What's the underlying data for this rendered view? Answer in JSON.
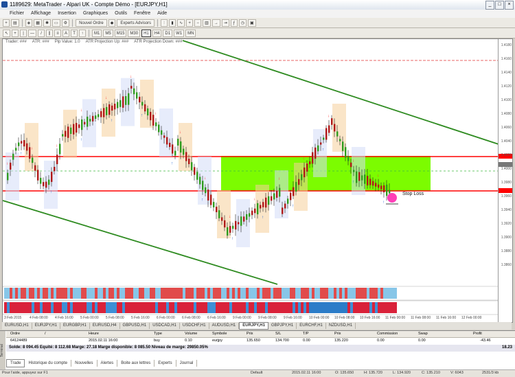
{
  "window": {
    "title": "1189629: MetaTrader - Alpari UK - Compte Démo - [EURJPY,H1]",
    "controls": [
      "_",
      "□",
      "×"
    ]
  },
  "menu": [
    "Fichier",
    "Affichage",
    "Insertion",
    "Graphiques",
    "Outils",
    "Fenêtre",
    "Aide"
  ],
  "toolbar1": {
    "new_order": "Nouvel Ordre",
    "experts": "Experts Advisors"
  },
  "toolbar2": {
    "timeframes": [
      "M1",
      "M5",
      "M15",
      "M30",
      "H1",
      "H4",
      "D1",
      "W1",
      "MN"
    ]
  },
  "chart": {
    "indicators": [
      "Trader: ###",
      "ATR: ###",
      "Pip Value: 1.0",
      "ATR Projection Up: ###",
      "ATR Projection Down: ###"
    ],
    "price_labels": [
      "1.4180",
      "1.4160",
      "1.4140",
      "1.4120",
      "1.4100",
      "1.4080",
      "1.4060",
      "1.4040",
      "1.4020",
      "1.4000",
      "1.3980",
      "1.3960",
      "1.3940",
      "1.3920",
      "1.3900",
      "1.3880",
      "1.3860"
    ],
    "time_labels": [
      "3 Feb 2015",
      "4 Feb 08:00",
      "4 Feb 16:00",
      "5 Feb 00:00",
      "5 Feb 08:00",
      "5 Feb 16:00",
      "6 Feb 00:00",
      "6 Feb 08:00",
      "6 Feb 16:00",
      "9 Feb 00:00",
      "9 Feb 08:00",
      "9 Feb 16:00",
      "10 Feb 00:00",
      "10 Feb 08:00",
      "10 Feb 16:00",
      "11 Feb 00:00",
      "11 Feb 08:00",
      "11 Feb 16:00",
      "12 Feb 00:00"
    ],
    "stop_loss_label": "Stop Loss",
    "colors": {
      "up_candle": "#2e9c1e",
      "down_candle": "#b01818",
      "channel": "#2e8b20",
      "zone": "#7cfc00",
      "resistance": "#ff0000",
      "support": "#ff0000"
    }
  },
  "chart_tabs": [
    "EURUSD,H1",
    "EURJPY,H1",
    "EURGBP,H1",
    "EURUSD,H4",
    "GBPUSD,H1",
    "USDCAD,H1",
    "USDCHF,H1",
    "AUDUSD,H1",
    "EURJPY,H1",
    "GBPJPY,H1",
    "EURCHF,H1",
    "NZDUSD,H1"
  ],
  "active_chart_tab": 8,
  "terminal": {
    "side_label": "Terminal",
    "headers": [
      "Ordre",
      "/",
      "Heure",
      "Type",
      "Volume",
      "Symbole",
      "Prix",
      "S/L",
      "T/P",
      "Prix",
      "Commission",
      "Swap",
      "Profit"
    ],
    "row": [
      "64124489",
      "2015.02.11 16:00",
      "buy",
      "0.10",
      "eurjpy",
      "135.650",
      "134.700",
      "0.00",
      "135.220",
      "0.00",
      "0.00",
      "-43.46"
    ],
    "balance": "Solde: 8 094.45  Equité: 8 112.68  Marge: 27.18  Marge disponible: 8 085.50  Niveau de marge: 29850.05%",
    "balance_total": "18.23",
    "tabs": [
      "Trade",
      "Historique du compte",
      "Nouvelles",
      "Alertes",
      "Boite aux lettres",
      "Experts",
      "Journal"
    ]
  },
  "status": {
    "help": "Pour l'aide, appuyez sur F1",
    "profile": "Default",
    "datetime": "2015.02.11 16:00",
    "o": "O: 135.650",
    "h": "H: 135.720",
    "l": "L: 134.920",
    "c": "C: 135.210",
    "v": "V: 6043",
    "kb": "2531/3 kb"
  }
}
